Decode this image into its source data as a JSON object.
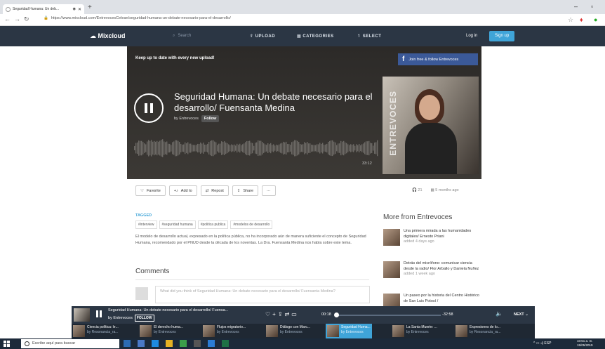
{
  "browser": {
    "tab_title": "Seguridad Humana: Un deb...",
    "url": "https://www.mixcloud.com/EntrevocesCelean/seguridad-humana-un-debate-necesario-para-el-desarrollo/"
  },
  "header": {
    "logo": "Mixcloud",
    "search_placeholder": "Search",
    "nav": [
      "UPLOAD",
      "CATEGORIES",
      "SELECT"
    ],
    "login": "Log in",
    "signup": "Sign up"
  },
  "hero": {
    "promo": "Keep up to date with every new upload!",
    "facebook_cta": "Join free & follow Entrevoces",
    "title": "Seguridad Humana: Un debate necesario para el desarrollo/ Fuensanta Medina",
    "by": "by Entrevoces",
    "follow": "Follow",
    "duration": "33:12",
    "cover_brand": "ENTREVOCES"
  },
  "actions": {
    "favorite": "Favorite",
    "add_to": "Add to",
    "repost": "Repost",
    "share": "Share",
    "more": "···",
    "plays": "21",
    "age": "5 months ago"
  },
  "tagged": {
    "label": "TAGGED",
    "tags": [
      "#interview",
      "#seguridad humana",
      "#politica publica",
      "#modelos de desarrollo"
    ]
  },
  "description": "El modelo de desarrollo actual, expresado en la política pública, no ha incorporado aún de manera suficiente el concepto de Seguridad Humana, recomendado por el PNUD desde la década de los noventas. La Dra. Fuensanta Medina nos habla sobre este tema.",
  "comments": {
    "title": "Comments",
    "placeholder": "What did you think of Seguridad Humana: Un debate necesario para el desarrollo/ Fuensanta Medina?"
  },
  "more": {
    "title": "More from Entrevoces",
    "items": [
      {
        "title": "Una primera mirada a las humanidades digitales/ Ernesto Priani",
        "ago": "added 4 days ago"
      },
      {
        "title": "Detrás del micrófono: comunicar ciencia desde la radio/ Flor Arballo y Daniela Nuñez",
        "ago": "added 1 week ago"
      },
      {
        "title": "Un paseo por la historia del Centro Histórico de San Luis Potosí /",
        "ago": ""
      }
    ]
  },
  "player": {
    "title": "Seguridad Humana: Un debate necesario para el desarrollo/ Fuensa...",
    "by": "by Entrevoces",
    "follow": "FOLLOW",
    "current": "00:18",
    "remaining": "-32:58",
    "progress": 0.009,
    "next": "NEXT"
  },
  "upnext": [
    {
      "title": "Ciencia política: le...",
      "by": "by Resonancia_ra..."
    },
    {
      "title": "El derecho huma...",
      "by": "by Entrevoces"
    },
    {
      "title": "Flujos migratorio...",
      "by": "by Entrevoces"
    },
    {
      "title": "Diálogo con Marc...",
      "by": "by Entrevoces"
    },
    {
      "title": "Seguridad Huma...",
      "by": "by Entrevoces"
    },
    {
      "title": "La Santa Muerte: ...",
      "by": "by Entrevoces"
    },
    {
      "title": "Expresiones de lo...",
      "by": "by Resonancia_ra..."
    }
  ],
  "taskbar": {
    "search": "Escribe aquí para buscar",
    "tray": "ESP",
    "time": "10:51 a. m.",
    "date": "15/05/2019"
  },
  "colors": {
    "header_bg": "#2b3644",
    "accent": "#3fa4d8",
    "facebook": "#3b5998"
  }
}
